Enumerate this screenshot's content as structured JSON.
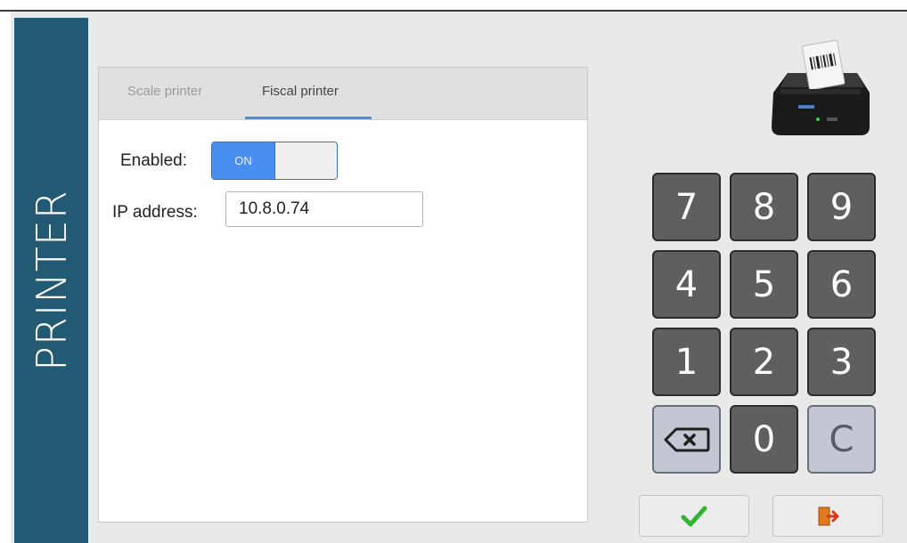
{
  "sidebar": {
    "title": "PRINTER"
  },
  "tabs": [
    {
      "label": "Scale printer",
      "active": false
    },
    {
      "label": "Fiscal printer",
      "active": true
    }
  ],
  "form": {
    "enabled_label": "Enabled:",
    "enabled_toggle": {
      "value": "ON",
      "state": true
    },
    "ip_label": "IP address:",
    "ip_value": "10.8.0.74"
  },
  "keypad": {
    "row1": [
      "7",
      "8",
      "9"
    ],
    "row2": [
      "4",
      "5",
      "6"
    ],
    "row3": [
      "1",
      "2",
      "3"
    ],
    "row4": {
      "backspace_icon": "backspace-icon",
      "zero": "0",
      "clear": "C"
    }
  },
  "actions": {
    "confirm_icon": "checkmark-icon",
    "exit_icon": "exit-door-icon"
  },
  "icons": {
    "printer": "receipt-printer-icon"
  },
  "colors": {
    "sidebar": "#225a73",
    "accent": "#4a90e2",
    "key_dark": "#5f5f5f",
    "key_light": "#c2c7d1",
    "confirm": "#2fb52f",
    "exit": "#e07a1f"
  }
}
